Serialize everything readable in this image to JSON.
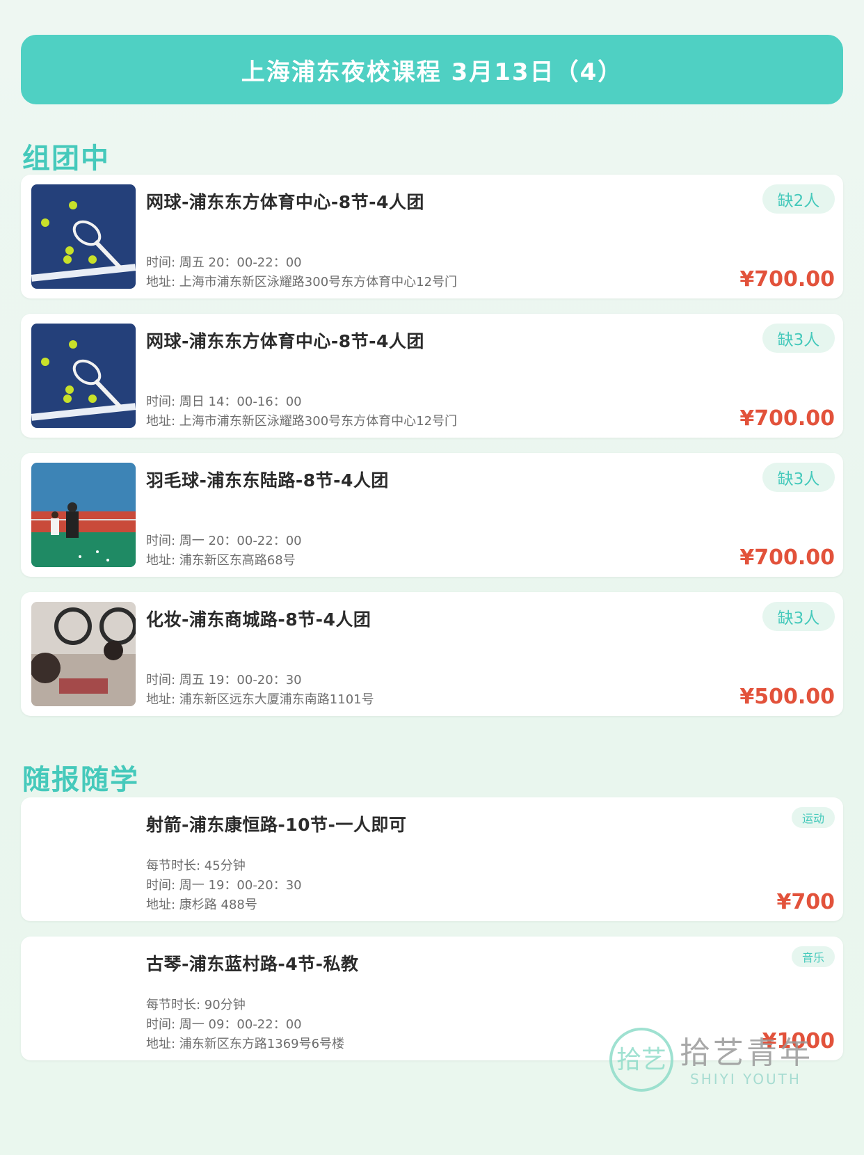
{
  "header": {
    "title": "上海浦东夜校课程 3月13日（4）"
  },
  "sections": {
    "group": "组团中",
    "anytime": "随报随学"
  },
  "colors": {
    "accent": "#4fd0c3",
    "price": "#e2523b",
    "badge_bg": "#e6f6ef"
  },
  "group_courses": [
    {
      "title": "网球-浦东东方体育中心-8节-4人团",
      "badge": "缺2人",
      "time": "时间: 周五 20：00-22：00",
      "address": "地址: 上海市浦东新区泳耀路300号东方体育中心12号门",
      "price": "¥700.00",
      "image": "tennis-image"
    },
    {
      "title": "网球-浦东东方体育中心-8节-4人团",
      "badge": "缺3人",
      "time": "时间: 周日 14：00-16：00",
      "address": "地址: 上海市浦东新区泳耀路300号东方体育中心12号门",
      "price": "¥700.00",
      "image": "tennis-image"
    },
    {
      "title": "羽毛球-浦东东陆路-8节-4人团",
      "badge": "缺3人",
      "time": "时间: 周一 20：00-22：00",
      "address": "地址: 浦东新区东高路68号",
      "price": "¥700.00",
      "image": "badminton-image"
    },
    {
      "title": "化妆-浦东商城路-8节-4人团",
      "badge": "缺3人",
      "time": "时间: 周五 19：00-20：30",
      "address": "地址: 浦东新区远东大厦浦东南路1101号",
      "price": "¥500.00",
      "image": "makeup-image"
    }
  ],
  "anytime_courses": [
    {
      "title": "射箭-浦东康恒路-10节-一人即可",
      "badge": "运动",
      "duration": "每节时长: 45分钟",
      "time": "时间: 周一 19：00-20：30",
      "address": "地址: 康杉路 488号",
      "price": "¥700"
    },
    {
      "title": "古琴-浦东蓝村路-4节-私教",
      "badge": "音乐",
      "duration": "每节时长: 90分钟",
      "time": "时间: 周一 09：00-22：00",
      "address": "地址: 浦东新区东方路1369号6号楼",
      "price": "¥1000"
    }
  ],
  "watermark": {
    "logo_text": "拾艺",
    "cn": "拾艺青年",
    "en": "SHIYI YOUTH"
  }
}
